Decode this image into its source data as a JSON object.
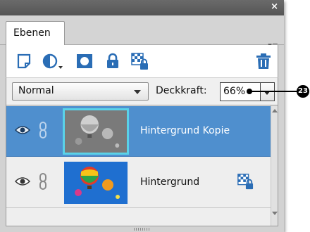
{
  "window": {
    "close_glyph": "×"
  },
  "tabs": [
    {
      "label": "Ebenen"
    }
  ],
  "panel_menu_glyph": "▾≡",
  "toolbar": {
    "tools": [
      {
        "icon": "new-layer-icon"
      },
      {
        "icon": "adjustment-layer-icon"
      },
      {
        "icon": "layer-mask-icon"
      },
      {
        "icon": "lock-icon"
      },
      {
        "icon": "lock-transparent-icon"
      },
      {
        "icon": "trash-icon"
      }
    ]
  },
  "options": {
    "blend_mode": "Normal",
    "opacity_label": "Deckkraft:",
    "opacity_value": "66%"
  },
  "layers": [
    {
      "name": "Hintergrund Kopie",
      "selected": true,
      "visible": true,
      "locked": false
    },
    {
      "name": "Hintergrund",
      "selected": false,
      "visible": true,
      "locked": true
    }
  ],
  "callout": {
    "number": "23"
  },
  "colors": {
    "selection": "#4f8fce",
    "accent_blue": "#2a6db5",
    "thumb_highlight": "#5ad2e8"
  }
}
